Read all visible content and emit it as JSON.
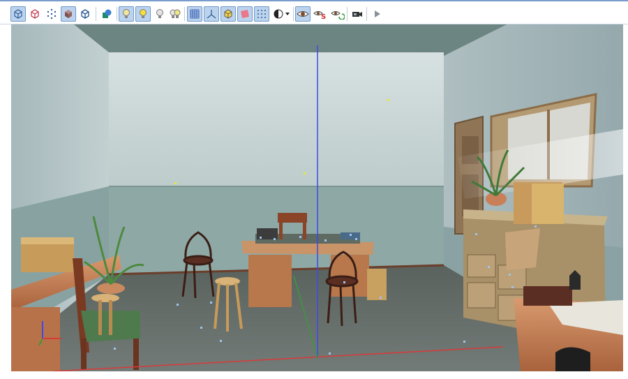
{
  "toolbar": {
    "buttons": [
      {
        "icon": "box-wireframe-icon",
        "pressed": true
      },
      {
        "icon": "box-edges-icon",
        "pressed": false
      },
      {
        "icon": "vertex-points-icon",
        "pressed": false
      },
      {
        "icon": "solid-box-icon",
        "pressed": true
      },
      {
        "icon": "box-outline-icon",
        "pressed": false
      },
      {
        "icon": "material-spheres-icon",
        "pressed": false
      },
      {
        "icon": "light-bulb-icon",
        "pressed": true
      },
      {
        "icon": "light-bulb-lit-icon",
        "pressed": true
      },
      {
        "icon": "light-bulb-off-icon",
        "pressed": false
      },
      {
        "icon": "light-bulb-pair-icon",
        "pressed": false
      },
      {
        "icon": "grid-icon",
        "pressed": true
      },
      {
        "icon": "axes-icon",
        "pressed": true
      },
      {
        "icon": "bounding-box-icon",
        "pressed": true
      },
      {
        "icon": "plane-icon",
        "pressed": true
      },
      {
        "icon": "dotted-grid-icon",
        "pressed": true
      },
      {
        "icon": "shading-dropdown-icon",
        "pressed": false
      },
      {
        "icon": "eye-icon",
        "pressed": true
      },
      {
        "icon": "eye-s-icon",
        "pressed": false
      },
      {
        "icon": "eye-cycle-icon",
        "pressed": false
      },
      {
        "icon": "camera-icon",
        "pressed": false
      },
      {
        "icon": "play-icon",
        "pressed": false
      }
    ]
  },
  "viewport": {
    "description_icon": "3d-scene-view",
    "colors": {
      "wall": "#c9d6d6",
      "wainscot": "#8ea8a7",
      "floor": "#5b6560",
      "axis_x": "#d83a3a",
      "axis_y": "#3a9a3a",
      "axis_z": "#3f4ae6",
      "light_marker": "#e8e830",
      "handle": "#9fc6f0"
    }
  }
}
